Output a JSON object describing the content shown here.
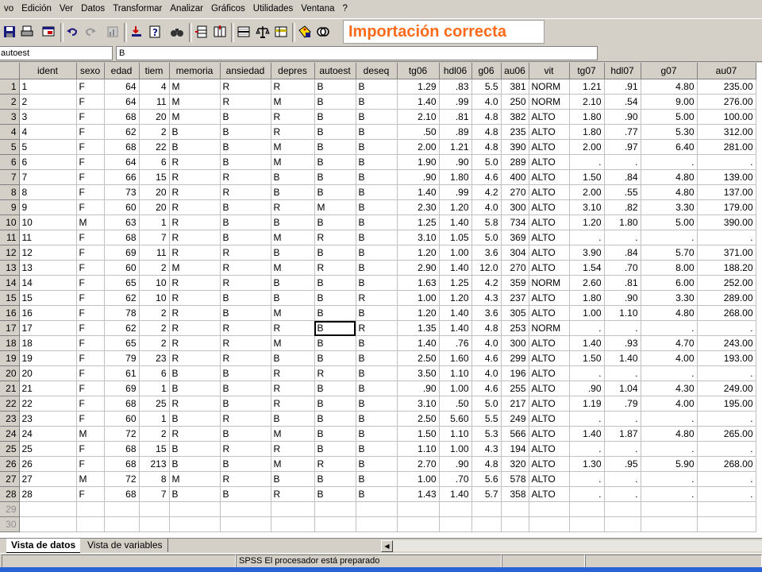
{
  "menu": [
    "vo",
    "Edición",
    "Ver",
    "Datos",
    "Transformar",
    "Analizar",
    "Gráficos",
    "Utilidades",
    "Ventana",
    "?"
  ],
  "toolbar": {
    "icons": [
      "save-icon",
      "print-icon",
      "dialog-recall-icon",
      "undo-icon",
      "redo-icon",
      "goto-chart-icon",
      "goto-case-icon",
      "variables-icon",
      "find-icon",
      "insert-cases-icon",
      "insert-variable-icon",
      "split-file-icon",
      "weight-cases-icon",
      "select-cases-icon",
      "value-labels-icon",
      "use-sets-icon"
    ],
    "banner": "Importación correcta",
    "banner_color": "#ff6a1a"
  },
  "cell_editor": {
    "name": "autoest",
    "value": "B"
  },
  "grid": {
    "columns": [
      "ident",
      "sexo",
      "edad",
      "tiem",
      "memoria",
      "ansiedad",
      "depres",
      "autoest",
      "deseq",
      "tg06",
      "hdl06",
      "g06",
      "au06",
      "vit",
      "tg07",
      "hdl07",
      "g07",
      "au07"
    ],
    "rows": [
      [
        "1",
        "F",
        "64",
        "4",
        "M",
        "R",
        "R",
        "B",
        "B",
        "1.29",
        ".83",
        "5.5",
        "381",
        "NORM",
        "1.21",
        ".91",
        "4.80",
        "235.00"
      ],
      [
        "2",
        "F",
        "64",
        "11",
        "M",
        "R",
        "M",
        "B",
        "B",
        "1.40",
        ".99",
        "4.0",
        "250",
        "NORM",
        "2.10",
        ".54",
        "9.00",
        "276.00"
      ],
      [
        "3",
        "F",
        "68",
        "20",
        "M",
        "B",
        "R",
        "B",
        "B",
        "2.10",
        ".81",
        "4.8",
        "382",
        "ALTO",
        "1.80",
        ".90",
        "5.00",
        "100.00"
      ],
      [
        "4",
        "F",
        "62",
        "2",
        "B",
        "B",
        "R",
        "B",
        "B",
        ".50",
        ".89",
        "4.8",
        "235",
        "ALTO",
        "1.80",
        ".77",
        "5.30",
        "312.00"
      ],
      [
        "5",
        "F",
        "68",
        "22",
        "B",
        "B",
        "M",
        "B",
        "B",
        "2.00",
        "1.21",
        "4.8",
        "390",
        "ALTO",
        "2.00",
        ".97",
        "6.40",
        "281.00"
      ],
      [
        "6",
        "F",
        "64",
        "6",
        "R",
        "B",
        "M",
        "B",
        "B",
        "1.90",
        ".90",
        "5.0",
        "289",
        "ALTO",
        ".",
        ".",
        ".",
        "."
      ],
      [
        "7",
        "F",
        "66",
        "15",
        "R",
        "R",
        "B",
        "B",
        "B",
        ".90",
        "1.80",
        "4.6",
        "400",
        "ALTO",
        "1.50",
        ".84",
        "4.80",
        "139.00"
      ],
      [
        "8",
        "F",
        "73",
        "20",
        "R",
        "R",
        "B",
        "B",
        "B",
        "1.40",
        ".99",
        "4.2",
        "270",
        "ALTO",
        "2.00",
        ".55",
        "4.80",
        "137.00"
      ],
      [
        "9",
        "F",
        "60",
        "20",
        "R",
        "B",
        "R",
        "M",
        "B",
        "2.30",
        "1.20",
        "4.0",
        "300",
        "ALTO",
        "3.10",
        ".82",
        "3.30",
        "179.00"
      ],
      [
        "10",
        "M",
        "63",
        "1",
        "R",
        "B",
        "B",
        "B",
        "B",
        "1.25",
        "1.40",
        "5.8",
        "734",
        "ALTO",
        "1.20",
        "1.80",
        "5.00",
        "390.00"
      ],
      [
        "11",
        "F",
        "68",
        "7",
        "R",
        "B",
        "M",
        "R",
        "B",
        "3.10",
        "1.05",
        "5.0",
        "369",
        "ALTO",
        ".",
        ".",
        ".",
        "."
      ],
      [
        "12",
        "F",
        "69",
        "11",
        "R",
        "R",
        "B",
        "B",
        "B",
        "1.20",
        "1.00",
        "3.6",
        "304",
        "ALTO",
        "3.90",
        ".84",
        "5.70",
        "371.00"
      ],
      [
        "13",
        "F",
        "60",
        "2",
        "M",
        "R",
        "M",
        "R",
        "B",
        "2.90",
        "1.40",
        "12.0",
        "270",
        "ALTO",
        "1.54",
        ".70",
        "8.00",
        "188.20"
      ],
      [
        "14",
        "F",
        "65",
        "10",
        "R",
        "R",
        "B",
        "B",
        "B",
        "1.63",
        "1.25",
        "4.2",
        "359",
        "NORM",
        "2.60",
        ".81",
        "6.00",
        "252.00"
      ],
      [
        "15",
        "F",
        "62",
        "10",
        "R",
        "B",
        "B",
        "B",
        "R",
        "1.00",
        "1.20",
        "4.3",
        "237",
        "ALTO",
        "1.80",
        ".90",
        "3.30",
        "289.00"
      ],
      [
        "16",
        "F",
        "78",
        "2",
        "R",
        "B",
        "M",
        "B",
        "B",
        "1.20",
        "1.40",
        "3.6",
        "305",
        "ALTO",
        "1.00",
        "1.10",
        "4.80",
        "268.00"
      ],
      [
        "17",
        "F",
        "62",
        "2",
        "R",
        "R",
        "R",
        "B",
        "R",
        "1.35",
        "1.40",
        "4.8",
        "253",
        "NORM",
        ".",
        ".",
        ".",
        "."
      ],
      [
        "18",
        "F",
        "65",
        "2",
        "R",
        "R",
        "M",
        "B",
        "B",
        "1.40",
        ".76",
        "4.0",
        "300",
        "ALTO",
        "1.40",
        ".93",
        "4.70",
        "243.00"
      ],
      [
        "19",
        "F",
        "79",
        "23",
        "R",
        "R",
        "B",
        "B",
        "B",
        "2.50",
        "1.60",
        "4.6",
        "299",
        "ALTO",
        "1.50",
        "1.40",
        "4.00",
        "193.00"
      ],
      [
        "20",
        "F",
        "61",
        "6",
        "B",
        "B",
        "R",
        "R",
        "B",
        "3.50",
        "1.10",
        "4.0",
        "196",
        "ALTO",
        ".",
        ".",
        ".",
        "."
      ],
      [
        "21",
        "F",
        "69",
        "1",
        "B",
        "B",
        "R",
        "B",
        "B",
        ".90",
        "1.00",
        "4.6",
        "255",
        "ALTO",
        ".90",
        "1.04",
        "4.30",
        "249.00"
      ],
      [
        "22",
        "F",
        "68",
        "25",
        "R",
        "B",
        "R",
        "B",
        "B",
        "3.10",
        ".50",
        "5.0",
        "217",
        "ALTO",
        "1.19",
        ".79",
        "4.00",
        "195.00"
      ],
      [
        "23",
        "F",
        "60",
        "1",
        "B",
        "R",
        "B",
        "B",
        "B",
        "2.50",
        "5.60",
        "5.5",
        "249",
        "ALTO",
        ".",
        ".",
        ".",
        "."
      ],
      [
        "24",
        "M",
        "72",
        "2",
        "R",
        "B",
        "M",
        "B",
        "B",
        "1.50",
        "1.10",
        "5.3",
        "566",
        "ALTO",
        "1.40",
        "1.87",
        "4.80",
        "265.00"
      ],
      [
        "25",
        "F",
        "68",
        "15",
        "B",
        "R",
        "R",
        "B",
        "B",
        "1.10",
        "1.00",
        "4.3",
        "194",
        "ALTO",
        ".",
        ".",
        ".",
        "."
      ],
      [
        "26",
        "F",
        "68",
        "213",
        "B",
        "B",
        "M",
        "R",
        "B",
        "2.70",
        ".90",
        "4.8",
        "320",
        "ALTO",
        "1.30",
        ".95",
        "5.90",
        "268.00"
      ],
      [
        "27",
        "M",
        "72",
        "8",
        "M",
        "R",
        "B",
        "B",
        "B",
        "1.00",
        ".70",
        "5.6",
        "578",
        "ALTO",
        ".",
        ".",
        ".",
        "."
      ],
      [
        "28",
        "F",
        "68",
        "7",
        "B",
        "B",
        "R",
        "B",
        "B",
        "1.43",
        "1.40",
        "5.7",
        "358",
        "ALTO",
        ".",
        ".",
        ".",
        "."
      ]
    ],
    "empty_rows": [
      "29",
      "30"
    ],
    "selected_cell": {
      "row": 17,
      "column": "autoest"
    }
  },
  "tabs": {
    "data_view": "Vista de datos",
    "variable_view": "Vista de variables"
  },
  "status": {
    "processor": "SPSS El procesador  está preparado"
  }
}
